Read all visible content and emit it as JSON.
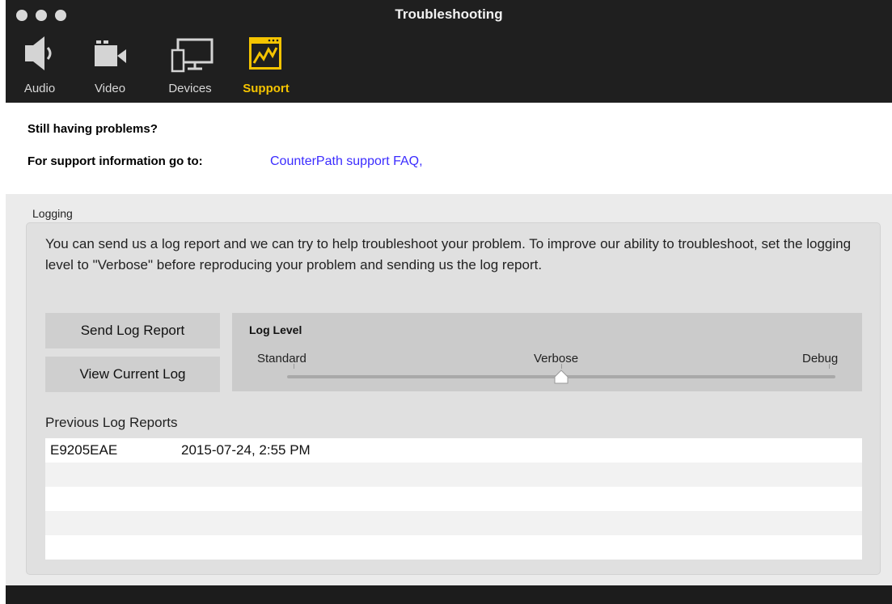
{
  "window": {
    "title": "Troubleshooting"
  },
  "toolbar": {
    "items": [
      {
        "label": "Audio",
        "icon": "speaker-icon",
        "active": false
      },
      {
        "label": "Video",
        "icon": "video-camera-icon",
        "active": false
      },
      {
        "label": "Devices",
        "icon": "devices-icon",
        "active": false
      },
      {
        "label": "Support",
        "icon": "support-chart-icon",
        "active": true
      }
    ],
    "active_color": "#f5c400"
  },
  "support": {
    "heading": "Still having problems?",
    "info_label": "For support information go to:",
    "faq_link": "CounterPath support FAQ,",
    "link_color": "#3b2cff"
  },
  "logging": {
    "group_title": "Logging",
    "description": "You can send us a log report and we can try to help troubleshoot your problem. To improve our ability to troubleshoot, set the logging level to \"Verbose\" before reproducing your problem and sending us the log report.",
    "send_button": "Send Log Report",
    "view_button": "View Current Log",
    "log_level": {
      "title": "Log Level",
      "options": [
        "Standard",
        "Verbose",
        "Debug"
      ],
      "selected": "Verbose"
    },
    "previous_title": "Previous Log Reports",
    "reports": [
      {
        "id": "E9205EAE",
        "date": "2015-07-24, 2:55 PM"
      }
    ]
  }
}
